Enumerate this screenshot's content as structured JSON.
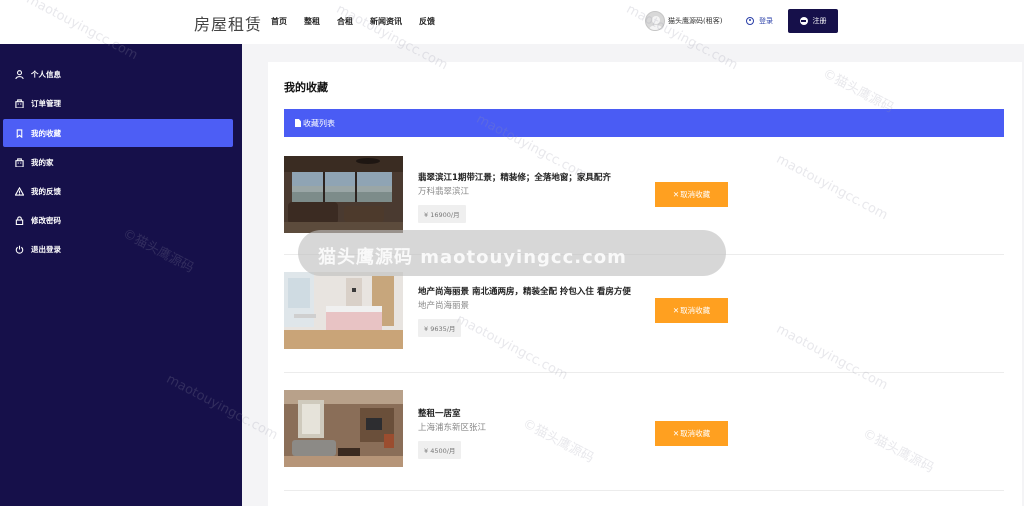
{
  "header": {
    "brand": "房屋租赁",
    "nav": [
      "首页",
      "整租",
      "合租",
      "新闻资讯",
      "反馈"
    ],
    "user_name": "猫头鹰源码(租客)",
    "login_label": "登录",
    "register_label": "注册"
  },
  "sidebar": {
    "items": [
      {
        "label": "个人信息",
        "icon": "user-icon"
      },
      {
        "label": "订单管理",
        "icon": "building-icon"
      },
      {
        "label": "我的收藏",
        "icon": "bookmark-icon",
        "active": true
      },
      {
        "label": "我的家",
        "icon": "building-icon"
      },
      {
        "label": "我的反馈",
        "icon": "warning-icon"
      },
      {
        "label": "修改密码",
        "icon": "lock-icon"
      },
      {
        "label": "退出登录",
        "icon": "power-icon"
      }
    ]
  },
  "main": {
    "title": "我的收藏",
    "panel_title": "收藏列表",
    "favorites": [
      {
        "title": "翡翠滨江1期带江景；精装修；全落地窗；家具配齐",
        "address": "万科翡翠滨江",
        "price": "¥ 16900/月",
        "action": "取消收藏"
      },
      {
        "title": "地产尚海丽景 南北通两房，精装全配 拎包入住 看房方便",
        "address": "地产尚海丽景",
        "price": "¥ 9635/月",
        "action": "取消收藏"
      },
      {
        "title": "整租一居室",
        "address": "上海浦东新区张江",
        "price": "¥ 4500/月",
        "action": "取消收藏"
      }
    ]
  },
  "watermark": {
    "banner": "猫头鹰源码 maotouyingcc.com",
    "diagonal": [
      "maotouyingcc.com",
      "©猫头鹰源码"
    ]
  },
  "colors": {
    "sidebar_bg": "#16104a",
    "accent_blue": "#4a5cf4",
    "cancel_orange": "#ffa020",
    "register_bg": "#16104a"
  }
}
